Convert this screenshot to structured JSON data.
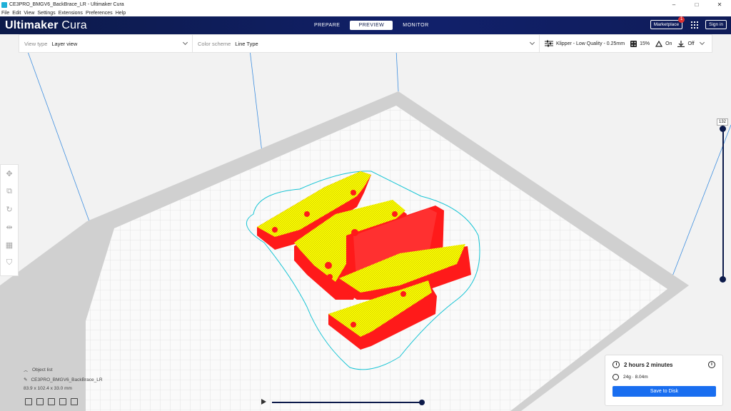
{
  "window": {
    "title": "CE3PRO_BMGV6_BackBrace_LR - Ultimaker Cura",
    "controls": [
      "–",
      "□",
      "✕"
    ]
  },
  "menu": [
    "File",
    "Edit",
    "View",
    "Settings",
    "Extensions",
    "Preferences",
    "Help"
  ],
  "header": {
    "brand_bold": "Ultimaker",
    "brand_light": " Cura",
    "tabs": [
      "PREPARE",
      "PREVIEW",
      "MONITOR"
    ],
    "active_tab": "PREVIEW",
    "marketplace_label": "Marketplace",
    "marketplace_badge": "1",
    "signin_label": "Sign in"
  },
  "toolbar": {
    "view_type_label": "View type",
    "view_type_value": "Layer view",
    "color_scheme_label": "Color scheme",
    "color_scheme_value": "Line Type",
    "print_profile": "Klipper - Low Quality - 0.25mm",
    "infill": "15%",
    "support": "On",
    "adhesion": "Off"
  },
  "layer_slider": {
    "current_layer": "132",
    "level": 1.0
  },
  "object_list": {
    "header": "Object list",
    "object_name": "CE3PRO_BMGV6_BackBrace_LR",
    "dimensions": "83.9 x 102.4 x 33.0 mm"
  },
  "timeline": {
    "progress": 1.0
  },
  "print_info": {
    "time": "2 hours 2 minutes",
    "material": "24g · 8.04m",
    "save_label": "Save to Disk"
  },
  "colors": {
    "header_bg": "#0c1a4a",
    "accent_blue": "#196ef0",
    "model_fill": "#ffff00",
    "model_wall": "#ff0000",
    "skirt": "#00c8d8"
  }
}
